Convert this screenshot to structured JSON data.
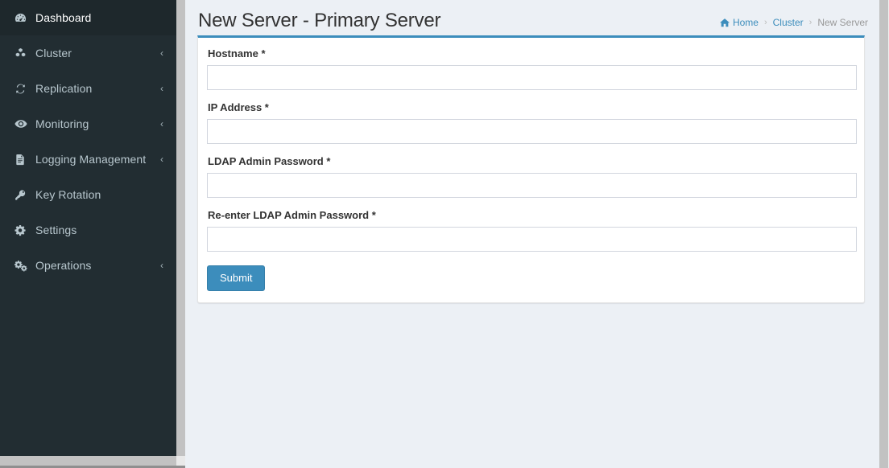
{
  "sidebar": {
    "items": [
      {
        "label": "Dashboard",
        "icon": "dashboard-icon",
        "expandable": false
      },
      {
        "label": "Cluster",
        "icon": "cubes-icon",
        "expandable": true,
        "arrow": "‹"
      },
      {
        "label": "Replication",
        "icon": "refresh-icon",
        "expandable": true,
        "arrow": "‹"
      },
      {
        "label": "Monitoring",
        "icon": "eye-icon",
        "expandable": true,
        "arrow": "‹"
      },
      {
        "label": "Logging Management",
        "icon": "file-icon",
        "expandable": true,
        "arrow": "‹"
      },
      {
        "label": "Key Rotation",
        "icon": "key-icon",
        "expandable": false
      },
      {
        "label": "Settings",
        "icon": "gear-icon",
        "expandable": false
      },
      {
        "label": "Operations",
        "icon": "gears-icon",
        "expandable": true,
        "arrow": "‹"
      }
    ]
  },
  "header": {
    "title": "New Server - Primary Server",
    "breadcrumb": {
      "home": "Home",
      "sep1": "›",
      "cluster": "Cluster",
      "sep2": "›",
      "current": "New Server"
    }
  },
  "form": {
    "fields": [
      {
        "label": "Hostname *",
        "value": "",
        "placeholder": "",
        "type": "text"
      },
      {
        "label": "IP Address *",
        "value": "",
        "placeholder": "",
        "type": "text"
      },
      {
        "label": "LDAP Admin Password *",
        "value": "",
        "placeholder": "",
        "type": "password"
      },
      {
        "label": "Re-enter LDAP Admin Password *",
        "value": "",
        "placeholder": "",
        "type": "password"
      }
    ],
    "submit_label": "Submit"
  },
  "colors": {
    "sidebar_bg": "#222d32",
    "sidebar_text": "#b8c7ce",
    "content_bg": "#ecf0f5",
    "accent": "#3c8dbc",
    "panel_bg": "#ffffff",
    "input_border": "#d2d6de",
    "scrollbar": "#c2c2c2"
  }
}
